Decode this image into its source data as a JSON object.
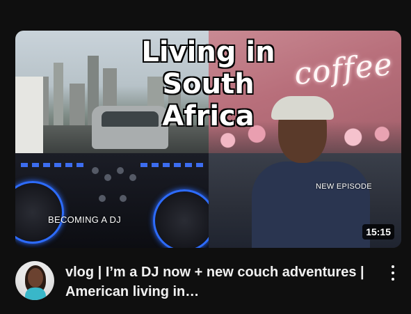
{
  "thumbnail": {
    "overlay_title_lines": [
      "Living in",
      "South",
      "Africa"
    ],
    "caption_left": "BECOMING A DJ",
    "caption_right": "NEW EPISODE",
    "neon_sign": "coffee",
    "duration": "15:15"
  },
  "video": {
    "title": "vlog | I’m a DJ now + new couch adventures | American living in…"
  },
  "icons": {
    "more": "more-vert-icon",
    "avatar": "channel-avatar"
  }
}
